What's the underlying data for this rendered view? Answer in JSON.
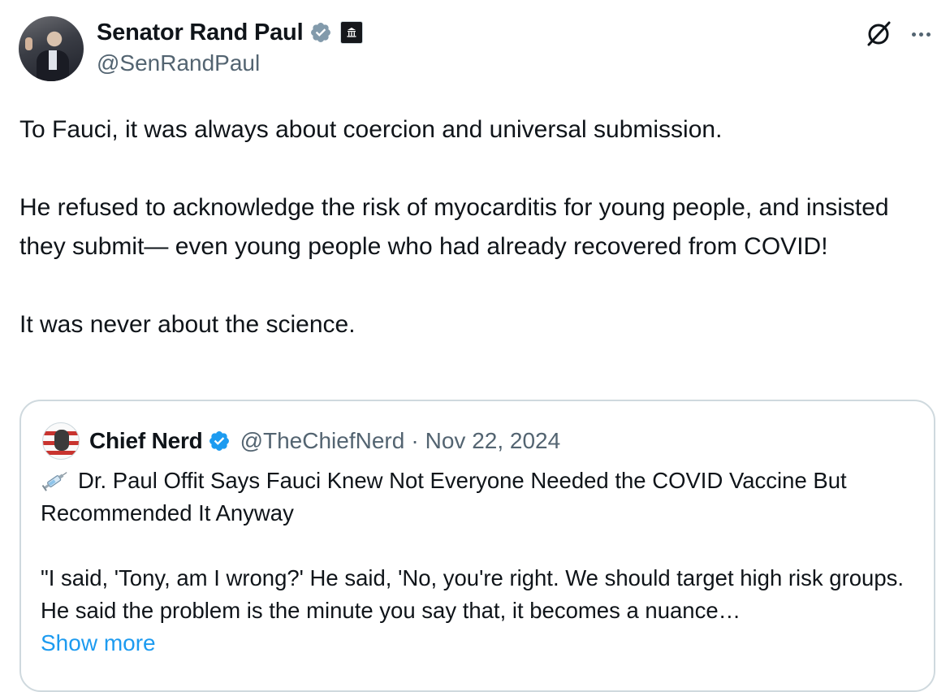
{
  "author": {
    "display_name": "Senator Rand Paul",
    "handle": "@SenRandPaul",
    "verified_badge_icon": "verified-badge-icon",
    "affiliation_badge_icon": "government-building-icon",
    "accent_color": "#829aab"
  },
  "header_actions": {
    "grok_icon": "grok-icon",
    "more_icon": "more-options-icon"
  },
  "tweet": {
    "paragraphs": [
      "To Fauci, it was always about coercion and universal submission.",
      "He refused to acknowledge the risk of myocarditis for young people, and insisted they submit— even young people who had already recovered from COVID!",
      "It was never about the science."
    ]
  },
  "quoted_tweet": {
    "display_name": "Chief Nerd",
    "handle": "@TheChiefNerd",
    "separator": "·",
    "date": "Nov 22, 2024",
    "verified_color": "#1d9bf0",
    "emoji_icon": "syringe-icon",
    "headline": "Dr. Paul Offit Says Fauci Knew Not Everyone Needed the COVID Vaccine But Recommended It Anyway",
    "body": "\"I said, 'Tony, am I wrong?' He said, 'No, you're right. We should target high risk groups. He said the problem is the minute you say that, it becomes a nuance…",
    "show_more": "Show more"
  }
}
